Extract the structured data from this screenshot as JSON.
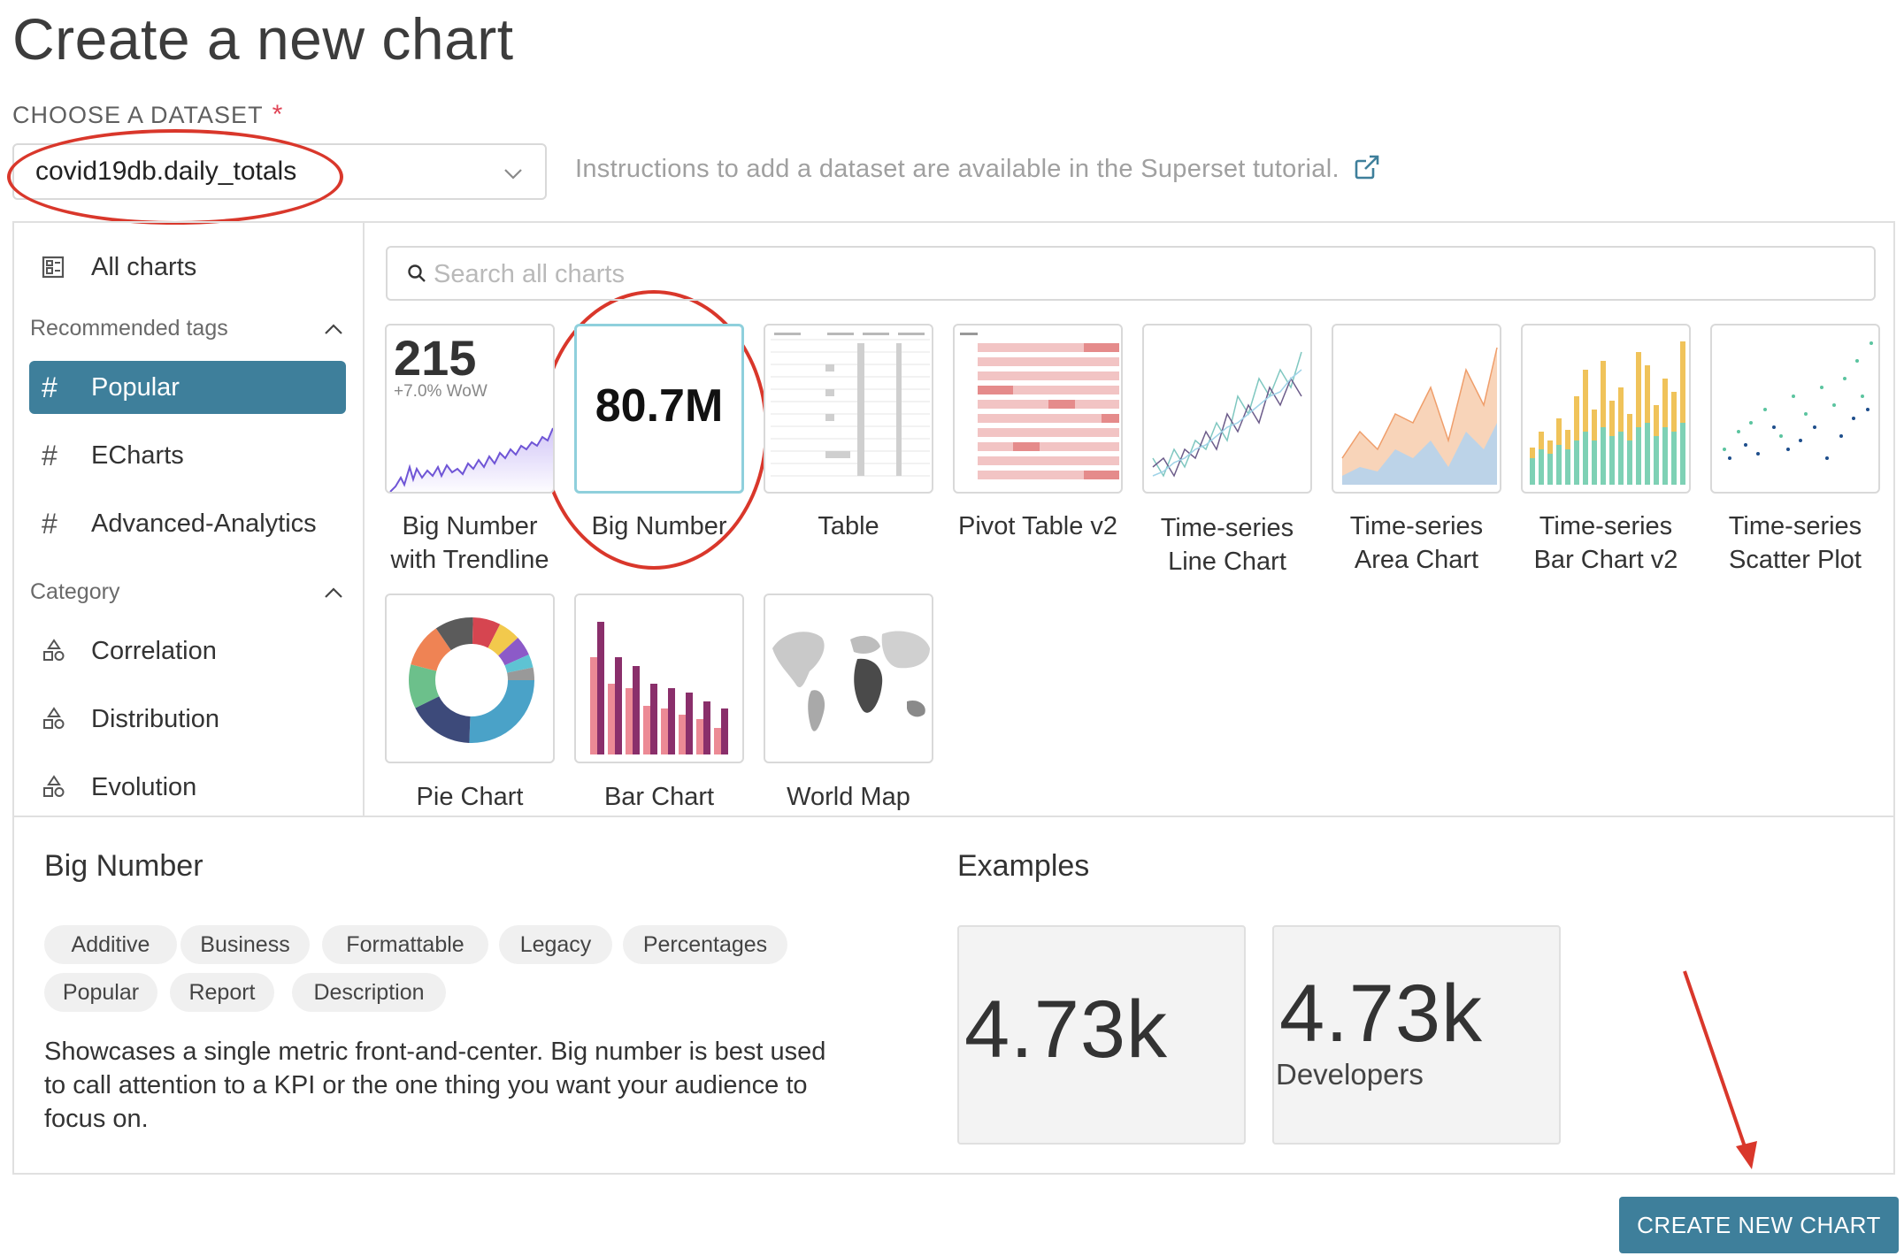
{
  "page": {
    "title": "Create a new chart"
  },
  "dataset": {
    "label": "CHOOSE A DATASET",
    "required_mark": "*",
    "value": "covid19db.daily_totals",
    "instructions": "Instructions to add a dataset are available in the Superset tutorial."
  },
  "sidebar": {
    "all_charts": "All charts",
    "recommended_header": "Recommended tags",
    "tags": [
      "Popular",
      "ECharts",
      "Advanced-Analytics"
    ],
    "category_header": "Category",
    "categories": [
      "Correlation",
      "Distribution",
      "Evolution"
    ]
  },
  "search": {
    "placeholder": "Search all charts"
  },
  "charts": [
    {
      "name_line1": "Big Number",
      "name_line2": "with Trendline",
      "thumb_value": "215",
      "thumb_sub": "+7.0% WoW"
    },
    {
      "name_line1": "Big Number",
      "name_line2": "",
      "thumb_value": "80.7M",
      "selected": true
    },
    {
      "name_line1": "Table",
      "name_line2": ""
    },
    {
      "name_line1": "Pivot Table v2",
      "name_line2": ""
    },
    {
      "name_line1": "Time-series",
      "name_line2": "Line Chart"
    },
    {
      "name_line1": "Time-series",
      "name_line2": "Area Chart"
    },
    {
      "name_line1": "Time-series",
      "name_line2": "Bar Chart v2"
    },
    {
      "name_line1": "Time-series",
      "name_line2": "Scatter Plot"
    },
    {
      "name_line1": "Pie Chart",
      "name_line2": ""
    },
    {
      "name_line1": "Bar Chart",
      "name_line2": ""
    },
    {
      "name_line1": "World Map",
      "name_line2": ""
    }
  ],
  "detail": {
    "title": "Big Number",
    "tags": [
      "Additive",
      "Business",
      "Formattable",
      "Legacy",
      "Percentages",
      "Popular",
      "Report",
      "Description"
    ],
    "description": "Showcases a single metric front-and-center. Big number is best used to call attention to a KPI or the one thing you want your audience to focus on.",
    "examples_title": "Examples",
    "examples": [
      {
        "value": "4.73k",
        "label": ""
      },
      {
        "value": "4.73k",
        "label": "Developers"
      }
    ]
  },
  "actions": {
    "create_label": "CREATE NEW CHART"
  },
  "colors": {
    "primary": "#3e7f9b",
    "annotation": "#d9372b",
    "selected_border": "#8fd0dc"
  },
  "icons": {
    "dataset_chevron": "chevron-down-icon",
    "instructions_link": "external-link-icon",
    "all_charts": "dashboard-icon",
    "tag": "hash-icon",
    "section_toggle": "chevron-up-icon",
    "category": "shapes-icon",
    "search": "search-icon"
  }
}
